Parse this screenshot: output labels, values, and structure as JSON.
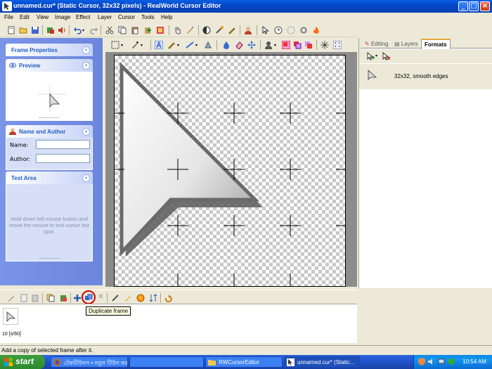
{
  "window": {
    "title": "unnamed.cur* (Static Cursor, 32x32 pixels) - RealWorld Cursor Editor",
    "caption_buttons": [
      "minimize",
      "maximize",
      "close"
    ]
  },
  "menu": [
    "File",
    "Edit",
    "View",
    "Image",
    "Effect",
    "Layer",
    "Cursor",
    "Tools",
    "Help"
  ],
  "left_panel": {
    "frame_properties": {
      "title": "Frame Properties"
    },
    "preview": {
      "title": "Preview"
    },
    "name_author": {
      "title": "Name and Author",
      "name_label": "Name:",
      "author_label": "Author:",
      "name_value": "",
      "author_value": ""
    },
    "test_area": {
      "title": "Test Area",
      "hint": "Hold down left mouse button and move the mouse to test cursor hot spot."
    }
  },
  "right_panel": {
    "tabs": [
      "Editing",
      "Layers",
      "Formats"
    ],
    "active_tab": "Formats",
    "format_item": "32x32, smooth edges"
  },
  "frames": {
    "tooltip": "Duplicate frame",
    "frame_label": "10 [s/60]"
  },
  "status": {
    "text": "Add a copy of selected frame after it."
  },
  "taskbar": {
    "start_label": "start",
    "tasks": [
      {
        "label": "টেকটিউনস • নতুন টিউন কর...",
        "active": false
      },
      {
        "label": "",
        "active": false
      },
      {
        "label": "RWCursorEditor",
        "active": false
      },
      {
        "label": "unnamed.cur* (Static...",
        "active": true
      }
    ],
    "clock": "10:54 AM"
  },
  "colors": {
    "titlebar": "#0a5fe3",
    "panel_blue": "#7a94e8",
    "highlight_red": "#d40000",
    "tooltip_bg": "#ffffe1"
  }
}
